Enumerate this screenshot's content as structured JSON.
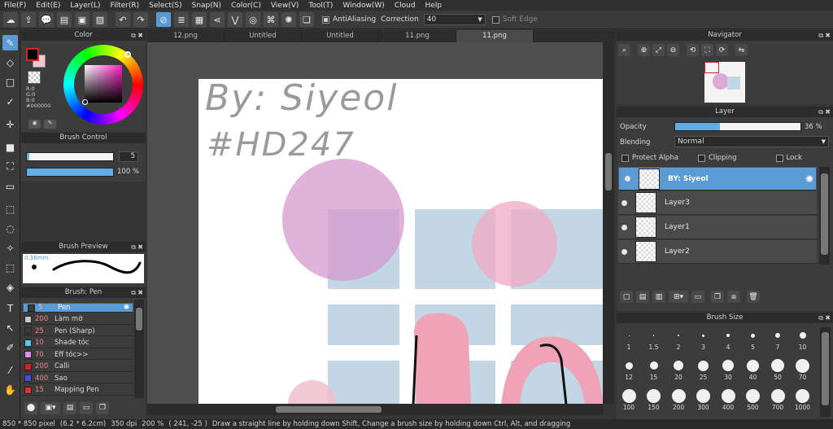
{
  "menu": [
    "File(F)",
    "Edit(E)",
    "Layer(L)",
    "Filter(R)",
    "Select(S)",
    "Snap(N)",
    "Color(C)",
    "View(V)",
    "Tool(T)",
    "Window(W)",
    "Cloud",
    "Help"
  ],
  "toolbar": {
    "antialiasing_label": "AntiAliasing",
    "correction_label": "Correction",
    "correction_value": "40",
    "soft_edge_label": "Soft Edge"
  },
  "tabs": [
    "12.png",
    "Untitled",
    "Untitled",
    "11.png",
    "11.png"
  ],
  "active_tab_index": 4,
  "color_panel": {
    "title": "Color",
    "readout": [
      "R:0",
      "G:0",
      "B:0",
      "#000000"
    ],
    "foreground": "#000000",
    "background": "#f0c8cc"
  },
  "brush_control": {
    "title": "Brush Control",
    "size_value": "5",
    "opacity_value": "100 %",
    "size_fraction": 0.02,
    "opacity_fraction": 1.0
  },
  "brush_preview": {
    "title": "Brush Preview",
    "size_label": "0.36mm"
  },
  "brush_list": {
    "title": "Brush: Pen",
    "items": [
      {
        "size": "5",
        "name": "Pen",
        "color": "#3a3a3a"
      },
      {
        "size": "200",
        "name": "Làm mờ",
        "color": "#c8c8c8"
      },
      {
        "size": "25",
        "name": "Pen (Sharp)",
        "color": "#3a3a3a"
      },
      {
        "size": "10",
        "name": "Shade tóc",
        "color": "#59c8f0"
      },
      {
        "size": "70",
        "name": "Eff tóc>>",
        "color": "#e090e8"
      },
      {
        "size": "200",
        "name": "Calli",
        "color": "#e02020"
      },
      {
        "size": "400",
        "name": "Sao",
        "color": "#4050e0"
      },
      {
        "size": "15",
        "name": "Mapping Pen",
        "color": "#e03030"
      }
    ]
  },
  "canvas": {
    "text_line1": "By: Siyeol",
    "text_line2": "#HD247"
  },
  "navigator": {
    "title": "Navigator"
  },
  "layer_panel": {
    "title": "Layer",
    "opacity_label": "Opacity",
    "opacity_value": "36 %",
    "opacity_fraction": 0.36,
    "blending_label": "Blending",
    "blending_value": "Normal",
    "protect_alpha_label": "Protect Alpha",
    "clipping_label": "Clipping",
    "lock_label": "Lock",
    "layers": [
      "BY: Siyeol",
      "Layer3",
      "Layer1",
      "Layer2"
    ]
  },
  "brush_size": {
    "title": "Brush Size",
    "sizes": [
      "1",
      "1.5",
      "2",
      "3",
      "4",
      "5",
      "7",
      "10",
      "12",
      "15",
      "20",
      "25",
      "30",
      "40",
      "50",
      "70",
      "100",
      "150",
      "200",
      "300",
      "400",
      "500",
      "700",
      "1000"
    ]
  },
  "status": {
    "dimensions": "850 * 850 pixel",
    "physical": "(6.2 * 6.2cm)",
    "dpi": "350 dpi",
    "zoom": "200 %",
    "coords": "( 241, -25 )",
    "hint": "Draw a straight line by holding down Shift, Change a brush size by holding down Ctrl, Alt, and dragging"
  }
}
